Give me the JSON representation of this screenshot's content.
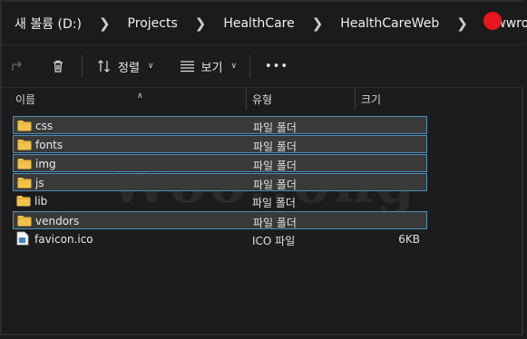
{
  "breadcrumb": {
    "items": [
      "새 볼륨 (D:)",
      "Projects",
      "HealthCare",
      "HealthCareWeb",
      "wwwroot"
    ]
  },
  "toolbar": {
    "sort_label": "정렬",
    "view_label": "보기",
    "more_label": "•••"
  },
  "columns": {
    "name": "이름",
    "type": "유형",
    "size": "크기"
  },
  "files": [
    {
      "name": "css",
      "type": "파일 폴더",
      "size": "",
      "icon": "folder-icon",
      "selected": true
    },
    {
      "name": "fonts",
      "type": "파일 폴더",
      "size": "",
      "icon": "folder-icon",
      "selected": true
    },
    {
      "name": "img",
      "type": "파일 폴더",
      "size": "",
      "icon": "folder-icon",
      "selected": true
    },
    {
      "name": "js",
      "type": "파일 폴더",
      "size": "",
      "icon": "folder-icon",
      "selected": true
    },
    {
      "name": "lib",
      "type": "파일 폴더",
      "size": "",
      "icon": "folder-icon",
      "selected": false
    },
    {
      "name": "vendors",
      "type": "파일 폴더",
      "size": "",
      "icon": "folder-icon",
      "selected": true
    },
    {
      "name": "favicon.ico",
      "type": "ICO 파일",
      "size": "6KB",
      "icon": "ico-file-icon",
      "selected": false
    }
  ],
  "watermark": "Woo..ong",
  "colors": {
    "selection_border": "#4d8fb6",
    "folder": "#f2c24a",
    "record_dot": "#e8141e"
  }
}
